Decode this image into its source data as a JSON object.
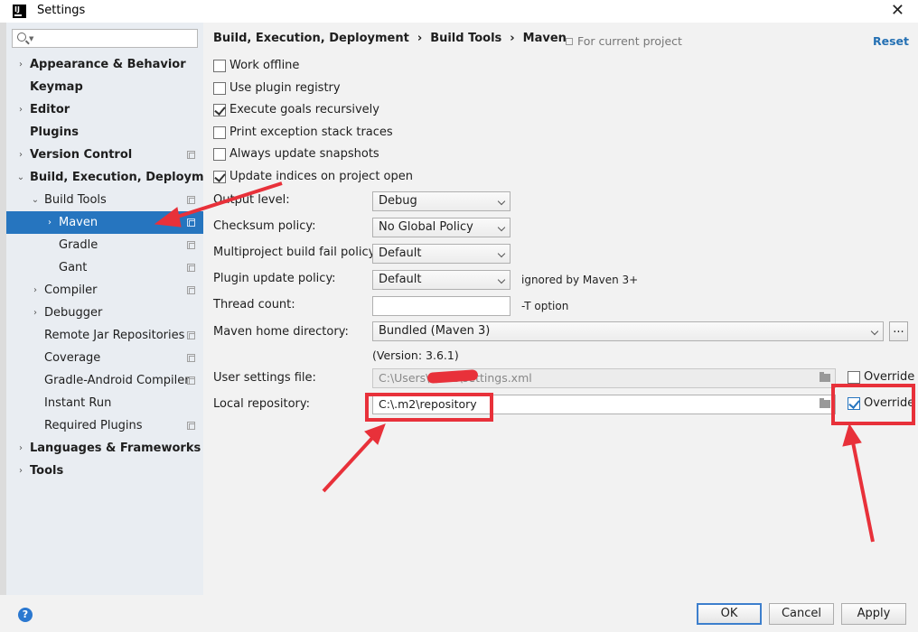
{
  "window": {
    "title": "Settings",
    "app_icon": "IJ"
  },
  "sidebar": {
    "search_placeholder": "Q-",
    "items": [
      {
        "label": "Appearance & Behavior",
        "bold": true,
        "arrow": "›",
        "indent": 0,
        "project": false
      },
      {
        "label": "Keymap",
        "bold": true,
        "arrow": "",
        "indent": 0,
        "project": false
      },
      {
        "label": "Editor",
        "bold": true,
        "arrow": "›",
        "indent": 0,
        "project": false
      },
      {
        "label": "Plugins",
        "bold": true,
        "arrow": "",
        "indent": 0,
        "project": false
      },
      {
        "label": "Version Control",
        "bold": true,
        "arrow": "›",
        "indent": 0,
        "project": true
      },
      {
        "label": "Build, Execution, Deployment",
        "bold": true,
        "arrow": "⌄",
        "indent": 0,
        "project": false
      },
      {
        "label": "Build Tools",
        "bold": false,
        "arrow": "⌄",
        "indent": 1,
        "project": true
      },
      {
        "label": "Maven",
        "bold": false,
        "arrow": "›",
        "indent": 2,
        "project": true,
        "selected": true
      },
      {
        "label": "Gradle",
        "bold": false,
        "arrow": "",
        "indent": 2,
        "project": true
      },
      {
        "label": "Gant",
        "bold": false,
        "arrow": "",
        "indent": 2,
        "project": true
      },
      {
        "label": "Compiler",
        "bold": false,
        "arrow": "›",
        "indent": 1,
        "project": true
      },
      {
        "label": "Debugger",
        "bold": false,
        "arrow": "›",
        "indent": 1,
        "project": false
      },
      {
        "label": "Remote Jar Repositories",
        "bold": false,
        "arrow": "",
        "indent": 1,
        "project": true
      },
      {
        "label": "Coverage",
        "bold": false,
        "arrow": "",
        "indent": 1,
        "project": true
      },
      {
        "label": "Gradle-Android Compiler",
        "bold": false,
        "arrow": "",
        "indent": 1,
        "project": true
      },
      {
        "label": "Instant Run",
        "bold": false,
        "arrow": "",
        "indent": 1,
        "project": false
      },
      {
        "label": "Required Plugins",
        "bold": false,
        "arrow": "",
        "indent": 1,
        "project": true
      },
      {
        "label": "Languages & Frameworks",
        "bold": true,
        "arrow": "›",
        "indent": 0,
        "project": false
      },
      {
        "label": "Tools",
        "bold": true,
        "arrow": "›",
        "indent": 0,
        "project": false
      }
    ]
  },
  "main": {
    "breadcrumb": [
      "Build, Execution, Deployment",
      "Build Tools",
      "Maven"
    ],
    "breadcrumb_sep": "›",
    "for_project": "For current project",
    "reset": "Reset",
    "checkboxes": [
      {
        "label": "Work offline",
        "checked": false
      },
      {
        "label": "Use plugin registry",
        "checked": false
      },
      {
        "label": "Execute goals recursively",
        "checked": true
      },
      {
        "label": "Print exception stack traces",
        "checked": false
      },
      {
        "label": "Always update snapshots",
        "checked": false
      },
      {
        "label": "Update indices on project open",
        "checked": true
      }
    ],
    "output_level": {
      "label": "Output level:",
      "value": "Debug"
    },
    "checksum_policy": {
      "label": "Checksum policy:",
      "value": "No Global Policy"
    },
    "multiproject_policy": {
      "label": "Multiproject build fail policy:",
      "value": "Default"
    },
    "plugin_update_policy": {
      "label": "Plugin update policy:",
      "value": "Default",
      "hint": "ignored by Maven 3+"
    },
    "thread_count": {
      "label": "Thread count:",
      "value": "",
      "hint": "-T option"
    },
    "maven_home": {
      "label": "Maven home directory:",
      "value": "Bundled (Maven 3)",
      "browse": "..."
    },
    "version": "(Version: 3.6.1)",
    "user_settings": {
      "label": "User settings file:",
      "value": "C:\\Users\\          \\.m2\\settings.xml",
      "override_label": "Override",
      "override_checked": false
    },
    "local_repo": {
      "label": "Local repository:",
      "value": "C:\\.m2\\repository",
      "override_label": "Override",
      "override_checked": true
    }
  },
  "footer": {
    "help": "?",
    "ok": "OK",
    "cancel": "Cancel",
    "apply": "Apply"
  },
  "annotation_color": "#e8313a"
}
